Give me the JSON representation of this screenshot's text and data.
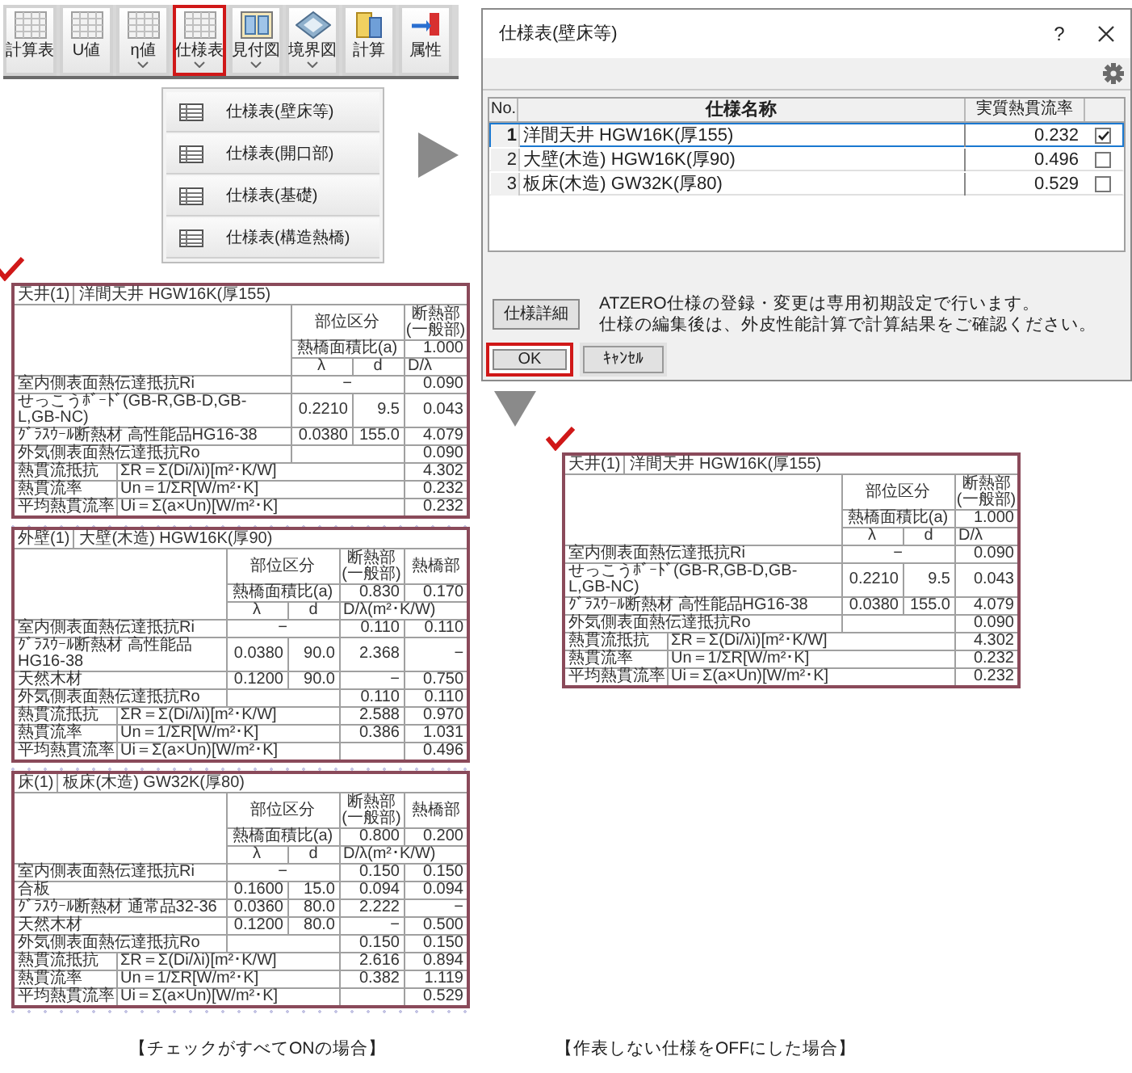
{
  "toolbar": {
    "buttons": [
      {
        "label": "計算表",
        "kind": "sheet",
        "dropdown": false,
        "highlighted": false
      },
      {
        "label": "U値",
        "kind": "sheet",
        "dropdown": false,
        "highlighted": false
      },
      {
        "label": "η値",
        "kind": "sheet",
        "dropdown": true,
        "highlighted": false
      },
      {
        "label": "仕様表",
        "kind": "sheet",
        "dropdown": true,
        "highlighted": true
      },
      {
        "label": "見付図",
        "kind": "panel",
        "dropdown": true,
        "highlighted": false
      },
      {
        "label": "境界図",
        "kind": "diamond",
        "dropdown": true,
        "highlighted": false
      },
      {
        "label": "計算",
        "kind": "block",
        "dropdown": false,
        "highlighted": false
      },
      {
        "label": "属性",
        "kind": "flag",
        "dropdown": false,
        "highlighted": false
      }
    ]
  },
  "menu": {
    "items": [
      {
        "label": "仕様表(壁床等)"
      },
      {
        "label": "仕様表(開口部)"
      },
      {
        "label": "仕様表(基礎)"
      },
      {
        "label": "仕様表(構造熱橋)"
      }
    ]
  },
  "dialog": {
    "title": "仕様表(壁床等)",
    "help": "?",
    "table": {
      "columns": [
        "No.",
        "仕様名称",
        "実質熱貫流率"
      ],
      "rows": [
        {
          "no": "1",
          "name": "洋間天井 HGW16K(厚155)",
          "value": "0.232",
          "checked": true,
          "selected": true
        },
        {
          "no": "2",
          "name": "大壁(木造) HGW16K(厚90)",
          "value": "0.496",
          "checked": false,
          "selected": false
        },
        {
          "no": "3",
          "name": "板床(木造) GW32K(厚80)",
          "value": "0.529",
          "checked": false,
          "selected": false
        }
      ]
    },
    "detail_button": "仕様詳細",
    "notes": [
      "ATZERO仕様の登録・変更は専用初期設定で行います。",
      "仕様の編集後は、外皮性能計算で計算結果をご確認ください。"
    ],
    "buttons": [
      {
        "label": "OK",
        "highlighted": true
      },
      {
        "label": "ｷｬﾝｾﾙ",
        "highlighted": false
      }
    ]
  },
  "results": [
    {
      "caption": "【チェックがすべてONの場合】",
      "tables": [
        {
          "tag": "天井(1)",
          "name": "洋間天井 HGW16K(厚155)",
          "header": "部位区分",
          "heads": [
            [
              "断熱部",
              "(一般部)"
            ]
          ],
          "ratio_label": "熱橋面積比(a)",
          "ratios": [
            "1.000"
          ],
          "lambda": "λ",
          "d": "d",
          "unit": "D/λ",
          "rows": [
            {
              "kind": "surface",
              "label": "室内側表面熱伝達抵抗Ri",
              "mid": "−",
              "values": [
                "0.090"
              ]
            },
            {
              "kind": "layer",
              "label": "せっこうﾎﾞｰﾄﾞ(GB-R,GB-D,GB-L,GB-NC)",
              "lambda": "0.2210",
              "d": "9.5",
              "values": [
                "0.043"
              ]
            },
            {
              "kind": "layer",
              "label": "ｸﾞﾗｽｳｰﾙ断熱材 高性能品HG16-38",
              "lambda": "0.0380",
              "d": "155.0",
              "values": [
                "4.079"
              ]
            },
            {
              "kind": "surface",
              "label": "外気側表面熱伝達抵抗Ro",
              "values": [
                "0.090"
              ]
            },
            {
              "kind": "formula",
              "label": "熱貫流抵抗",
              "formula": "ΣR＝Σ(Di/λi)[m²･K/W]",
              "values": [
                "4.302"
              ]
            },
            {
              "kind": "formula",
              "label": "熱貫流率",
              "formula": "Un＝1/ΣR[W/m²･K]",
              "values": [
                "0.232"
              ]
            },
            {
              "kind": "formula",
              "label": "平均熱貫流率",
              "formula": "Ui＝Σ(a×Un)[W/m²･K]",
              "values": [
                "0.232"
              ]
            }
          ]
        },
        {
          "tag": "外壁(1)",
          "name": "大壁(木造) HGW16K(厚90)",
          "header": "部位区分",
          "heads": [
            [
              "断熱部",
              "(一般部)"
            ],
            [
              "熱橋部"
            ]
          ],
          "ratio_label": "熱橋面積比(a)",
          "ratios": [
            "0.830",
            "0.170"
          ],
          "lambda": "λ",
          "d": "d",
          "unit": "D/λ(m²･K/W)",
          "rows": [
            {
              "kind": "surface",
              "label": "室内側表面熱伝達抵抗Ri",
              "mid": "−",
              "values": [
                "0.110",
                "0.110"
              ]
            },
            {
              "kind": "layer",
              "label": "ｸﾞﾗｽｳｰﾙ断熱材 高性能品HG16-38",
              "lambda": "0.0380",
              "d": "90.0",
              "values": [
                "2.368",
                "−"
              ]
            },
            {
              "kind": "layer",
              "label": "天然木材",
              "lambda": "0.1200",
              "d": "90.0",
              "values": [
                "−",
                "0.750"
              ]
            },
            {
              "kind": "surface",
              "label": "外気側表面熱伝達抵抗Ro",
              "values": [
                "0.110",
                "0.110"
              ]
            },
            {
              "kind": "formula",
              "label": "熱貫流抵抗",
              "formula": "ΣR＝Σ(Di/λi)[m²･K/W]",
              "values": [
                "2.588",
                "0.970"
              ]
            },
            {
              "kind": "formula",
              "label": "熱貫流率",
              "formula": "Un＝1/ΣR[W/m²･K]",
              "values": [
                "0.386",
                "1.031"
              ]
            },
            {
              "kind": "formula",
              "label": "平均熱貫流率",
              "formula": "Ui＝Σ(a×Un)[W/m²･K]",
              "values": [
                "0.496"
              ]
            }
          ]
        },
        {
          "tag": "床(1)",
          "name": "板床(木造) GW32K(厚80)",
          "header": "部位区分",
          "heads": [
            [
              "断熱部",
              "(一般部)"
            ],
            [
              "熱橋部"
            ]
          ],
          "ratio_label": "熱橋面積比(a)",
          "ratios": [
            "0.800",
            "0.200"
          ],
          "lambda": "λ",
          "d": "d",
          "unit": "D/λ(m²･K/W)",
          "rows": [
            {
              "kind": "surface",
              "label": "室内側表面熱伝達抵抗Ri",
              "mid": "−",
              "values": [
                "0.150",
                "0.150"
              ]
            },
            {
              "kind": "layer",
              "label": "合板",
              "lambda": "0.1600",
              "d": "15.0",
              "values": [
                "0.094",
                "0.094"
              ]
            },
            {
              "kind": "layer",
              "label": "ｸﾞﾗｽｳｰﾙ断熱材 通常品32-36",
              "lambda": "0.0360",
              "d": "80.0",
              "values": [
                "2.222",
                "−"
              ]
            },
            {
              "kind": "layer",
              "label": "天然木材",
              "lambda": "0.1200",
              "d": "80.0",
              "values": [
                "−",
                "0.500"
              ]
            },
            {
              "kind": "surface",
              "label": "外気側表面熱伝達抵抗Ro",
              "values": [
                "0.150",
                "0.150"
              ]
            },
            {
              "kind": "formula",
              "label": "熱貫流抵抗",
              "formula": "ΣR＝Σ(Di/λi)[m²･K/W]",
              "values": [
                "2.616",
                "0.894"
              ]
            },
            {
              "kind": "formula",
              "label": "熱貫流率",
              "formula": "Un＝1/ΣR[W/m²･K]",
              "values": [
                "0.382",
                "1.119"
              ]
            },
            {
              "kind": "formula",
              "label": "平均熱貫流率",
              "formula": "Ui＝Σ(a×Un)[W/m²･K]",
              "values": [
                "0.529"
              ]
            }
          ]
        }
      ]
    },
    {
      "caption": "【作表しない仕様をOFFにした場合】",
      "tables": [
        {
          "tag": "天井(1)",
          "name": "洋間天井 HGW16K(厚155)",
          "header": "部位区分",
          "heads": [
            [
              "断熱部",
              "(一般部)"
            ]
          ],
          "ratio_label": "熱橋面積比(a)",
          "ratios": [
            "1.000"
          ],
          "lambda": "λ",
          "d": "d",
          "unit": "D/λ",
          "rows": [
            {
              "kind": "surface",
              "label": "室内側表面熱伝達抵抗Ri",
              "mid": "−",
              "values": [
                "0.090"
              ]
            },
            {
              "kind": "layer",
              "label": "せっこうﾎﾞｰﾄﾞ(GB-R,GB-D,GB-L,GB-NC)",
              "lambda": "0.2210",
              "d": "9.5",
              "values": [
                "0.043"
              ]
            },
            {
              "kind": "layer",
              "label": "ｸﾞﾗｽｳｰﾙ断熱材 高性能品HG16-38",
              "lambda": "0.0380",
              "d": "155.0",
              "values": [
                "4.079"
              ]
            },
            {
              "kind": "surface",
              "label": "外気側表面熱伝達抵抗Ro",
              "values": [
                "0.090"
              ]
            },
            {
              "kind": "formula",
              "label": "熱貫流抵抗",
              "formula": "ΣR＝Σ(Di/λi)[m²･K/W]",
              "values": [
                "4.302"
              ]
            },
            {
              "kind": "formula",
              "label": "熱貫流率",
              "formula": "Un＝1/ΣR[W/m²･K]",
              "values": [
                "0.232"
              ]
            },
            {
              "kind": "formula",
              "label": "平均熱貫流率",
              "formula": "Ui＝Σ(a×Un)[W/m²･K]",
              "values": [
                "0.232"
              ]
            }
          ]
        }
      ]
    }
  ]
}
